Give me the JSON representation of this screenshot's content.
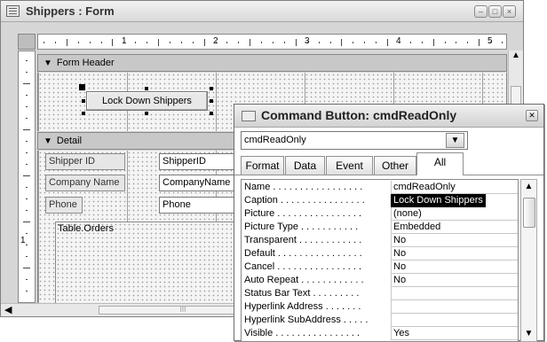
{
  "form_window": {
    "title": "Shippers : Form",
    "controls_labels": {
      "minimize": "–",
      "maximize": "□",
      "close": "×"
    },
    "ruler_numbers": [
      "1",
      "2",
      "3",
      "4",
      "5"
    ],
    "vruler_numbers": [
      "1"
    ],
    "sections": {
      "header": "Form Header",
      "detail": "Detail"
    },
    "button_label": "Lock Down Shippers",
    "fields": [
      {
        "label": "Shipper ID",
        "value": "ShipperID"
      },
      {
        "label": "Company Name",
        "value": "CompanyName"
      },
      {
        "label": "Phone",
        "value": "Phone"
      }
    ],
    "subform_label": "Table.Orders"
  },
  "property_sheet": {
    "title": "Command Button: cmdReadOnly",
    "selected_object": "cmdReadOnly",
    "tabs": [
      "Format",
      "Data",
      "Event",
      "Other",
      "All"
    ],
    "active_tab": "All",
    "properties": [
      {
        "name": "Name . . . . . . . . . . . . . . . . .",
        "value": "cmdReadOnly"
      },
      {
        "name": "Caption . . . . . . . . . . . . . . . .",
        "value": "Lock Down Shippers"
      },
      {
        "name": "Picture . . . . . . . . . . . . . . . .",
        "value": "(none)"
      },
      {
        "name": "Picture Type . . . . . . . . . . .",
        "value": "Embedded"
      },
      {
        "name": "Transparent . . . . . . . . . . . .",
        "value": "No"
      },
      {
        "name": "Default . . . . . . . . . . . . . . . .",
        "value": "No"
      },
      {
        "name": "Cancel . . . . . . . . . . . . . . . .",
        "value": "No"
      },
      {
        "name": "Auto Repeat . . . . . . . . . . . .",
        "value": "No"
      },
      {
        "name": "Status Bar Text . . . . . . . . .",
        "value": ""
      },
      {
        "name": "Hyperlink Address . . . . . . .",
        "value": ""
      },
      {
        "name": "Hyperlink SubAddress . . . . .",
        "value": ""
      },
      {
        "name": "Visible . . . . . . . . . . . . . . . .",
        "value": "Yes"
      }
    ],
    "selected_property_index": 1
  },
  "icons": {
    "form": "form-icon",
    "dropdown": "chevron-down-icon",
    "close": "close-icon",
    "section_arrow": "section-arrow-icon"
  }
}
